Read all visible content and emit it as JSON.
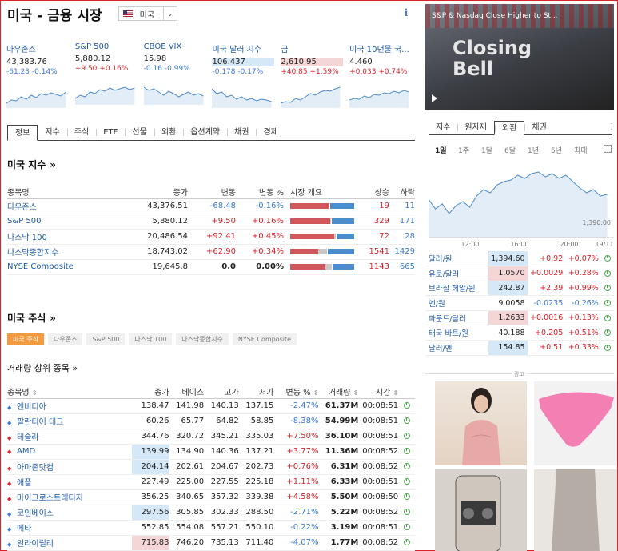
{
  "page": {
    "title": "미국 - 금융 시장",
    "country": "미국",
    "info": "i"
  },
  "tickers": [
    {
      "name": "다우존스",
      "value": "43,383.76",
      "change": "-61.23",
      "pct": "-0.14%",
      "dir": "dn",
      "hl": ""
    },
    {
      "name": "S&P 500",
      "value": "5,880.12",
      "change": "+9.50",
      "pct": "+0.16%",
      "dir": "up",
      "hl": ""
    },
    {
      "name": "CBOE VIX",
      "value": "15.98",
      "change": "-0.16",
      "pct": "-0.99%",
      "dir": "dn",
      "hl": ""
    },
    {
      "name": "미국 달러 지수",
      "value": "106.437",
      "change": "-0.178",
      "pct": "-0.17%",
      "dir": "dn",
      "hl": "hblue"
    },
    {
      "name": "금",
      "value": "2,610.95",
      "change": "+40.85",
      "pct": "+1.59%",
      "dir": "up",
      "hl": "hred"
    },
    {
      "name": "미국 10년물 국...",
      "value": "4.460",
      "change": "+0.033",
      "pct": "+0.74%",
      "dir": "up",
      "hl": ""
    }
  ],
  "tabs": [
    "정보",
    "지수",
    "주식",
    "ETF",
    "선물",
    "외환",
    "옵션계약",
    "채권",
    "경제"
  ],
  "indices": {
    "title": "미국 지수",
    "arrow": "»",
    "headers": [
      "종목명",
      "종가",
      "변동",
      "변동 %",
      "시장 개요",
      "상승",
      "하락"
    ],
    "rows": [
      {
        "name": "다우존스",
        "close": "43,376.51",
        "change": "-68.48",
        "pct": "-0.16%",
        "dir": "dn",
        "up": "19",
        "down": "11",
        "bar": [
          0.61,
          0.0,
          0.39
        ]
      },
      {
        "name": "S&P 500",
        "close": "5,880.12",
        "change": "+9.50",
        "pct": "+0.16%",
        "dir": "up",
        "up": "329",
        "down": "171",
        "bar": [
          0.62,
          0.02,
          0.36
        ]
      },
      {
        "name": "나스닥 100",
        "close": "20,486.54",
        "change": "+92.41",
        "pct": "+0.45%",
        "dir": "up",
        "up": "72",
        "down": "28",
        "bar": [
          0.69,
          0.02,
          0.29
        ]
      },
      {
        "name": "나스닥종합지수",
        "close": "18,743.02",
        "change": "+62.90",
        "pct": "+0.34%",
        "dir": "up",
        "up": "1541",
        "down": "1429",
        "bar": [
          0.44,
          0.13,
          0.43
        ]
      },
      {
        "name": "NYSE Composite",
        "close": "19,645.8",
        "change": "0.0",
        "pct": "0.00%",
        "dir": "flat",
        "up": "1143",
        "down": "665",
        "bar": [
          0.55,
          0.1,
          0.35
        ]
      }
    ]
  },
  "stocks": {
    "title": "미국 주식",
    "arrow": "»",
    "chips": [
      "미국 주식",
      "다우존스",
      "S&P 500",
      "나스닥 100",
      "나스닥종합지수",
      "NYSE Composite"
    ],
    "subtitle": "거래량 상위 종목 »",
    "headers": [
      "종목명",
      "종가",
      "베이스",
      "고가",
      "저가",
      "변동 %",
      "거래량",
      "시간"
    ],
    "sort_glyph": "⇕",
    "rows": [
      {
        "name": "엔비디아",
        "close": "138.47",
        "base": "141.98",
        "high": "140.13",
        "low": "137.15",
        "pct": "-2.47%",
        "dir": "dn",
        "vol": "61.37M",
        "time": "00:08:51",
        "hl": ""
      },
      {
        "name": "팔란티어 테크",
        "close": "60.26",
        "base": "65.77",
        "high": "64.82",
        "low": "58.85",
        "pct": "-8.38%",
        "dir": "dn",
        "vol": "54.99M",
        "time": "00:08:51",
        "hl": ""
      },
      {
        "name": "테슬라",
        "close": "344.76",
        "base": "320.72",
        "high": "345.21",
        "low": "335.03",
        "pct": "+7.50%",
        "dir": "up",
        "vol": "36.10M",
        "time": "00:08:51",
        "hl": ""
      },
      {
        "name": "AMD",
        "close": "139.99",
        "base": "134.90",
        "high": "140.36",
        "low": "137.21",
        "pct": "+3.77%",
        "dir": "up",
        "vol": "11.36M",
        "time": "00:08:52",
        "hl": "hb"
      },
      {
        "name": "아마존닷컴",
        "close": "204.14",
        "base": "202.61",
        "high": "204.67",
        "low": "202.73",
        "pct": "+0.76%",
        "dir": "up",
        "vol": "6.31M",
        "time": "00:08:52",
        "hl": "hb"
      },
      {
        "name": "애플",
        "close": "227.49",
        "base": "225.00",
        "high": "227.55",
        "low": "225.18",
        "pct": "+1.11%",
        "dir": "up",
        "vol": "6.33M",
        "time": "00:08:51",
        "hl": ""
      },
      {
        "name": "마이크로스트래티지",
        "close": "356.25",
        "base": "340.65",
        "high": "357.32",
        "low": "339.38",
        "pct": "+4.58%",
        "dir": "up",
        "vol": "5.50M",
        "time": "00:08:50",
        "hl": ""
      },
      {
        "name": "코인베이스",
        "close": "297.56",
        "base": "305.85",
        "high": "302.33",
        "low": "288.50",
        "pct": "-2.71%",
        "dir": "dn",
        "vol": "5.22M",
        "time": "00:08:52",
        "hl": "hb"
      },
      {
        "name": "메타",
        "close": "552.85",
        "base": "554.08",
        "high": "557.21",
        "low": "550.10",
        "pct": "-0.22%",
        "dir": "dn",
        "vol": "3.19M",
        "time": "00:08:51",
        "hl": ""
      },
      {
        "name": "일라이릴리",
        "close": "715.83",
        "base": "746.20",
        "high": "735.13",
        "low": "711.40",
        "pct": "-4.07%",
        "dir": "dn",
        "vol": "1.77M",
        "time": "00:08:52",
        "hl": "hr"
      }
    ]
  },
  "video": {
    "title": "S&P & Nasdaq Close Higher to St...",
    "overlay": "Closing Bell"
  },
  "forex": {
    "tabs": [
      "지수",
      "원자재",
      "외환",
      "채권"
    ],
    "periods": [
      "1일",
      "1주",
      "1달",
      "6달",
      "1년",
      "5년",
      "최대"
    ],
    "chart": {
      "ref_label": "1,390.00",
      "x_labels": [
        "12:00",
        "16:00",
        "20:00",
        "19/11"
      ]
    },
    "rows": [
      {
        "name": "달러/원",
        "value": "1,394.60",
        "change": "+0.92",
        "pct": "+0.07%",
        "dir": "up",
        "hl": "hb"
      },
      {
        "name": "유로/달러",
        "value": "1.0570",
        "change": "+0.0029",
        "pct": "+0.28%",
        "dir": "up",
        "hl": "hr"
      },
      {
        "name": "브라질 헤알/원",
        "value": "242.87",
        "change": "+2.39",
        "pct": "+0.99%",
        "dir": "up",
        "hl": "hb"
      },
      {
        "name": "엔/원",
        "value": "9.0058",
        "change": "-0.0235",
        "pct": "-0.26%",
        "dir": "dn",
        "hl": ""
      },
      {
        "name": "파운드/달러",
        "value": "1.2633",
        "change": "+0.0016",
        "pct": "+0.13%",
        "dir": "up",
        "hl": "hr"
      },
      {
        "name": "태국 바트/원",
        "value": "40.188",
        "change": "+0.205",
        "pct": "+0.51%",
        "dir": "up",
        "hl": ""
      },
      {
        "name": "달러/엔",
        "value": "154.85",
        "change": "+0.51",
        "pct": "+0.33%",
        "dir": "up",
        "hl": "hb"
      }
    ]
  },
  "ad": {
    "label": "광고"
  },
  "colors": {
    "up": "#d8232a",
    "down": "#3a7ad0",
    "bar_up": "#d0585c",
    "bar_down": "#4a8ccc",
    "bar_flat": "#c8c8c8",
    "accent": "#f39a3e"
  }
}
